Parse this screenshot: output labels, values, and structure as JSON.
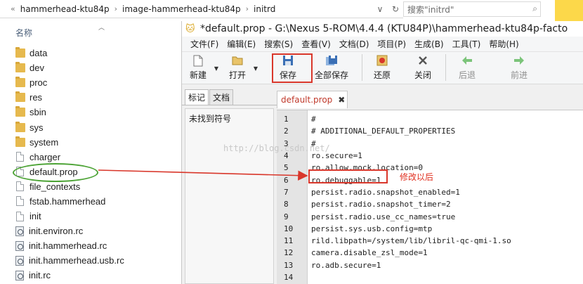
{
  "explorer": {
    "breadcrumbs": [
      "hammerhead-ktu84p",
      "image-hammerhead-ktu84p",
      "initrd"
    ],
    "search_placeholder": "搜索\"initrd\"",
    "column_name": "名称",
    "files": [
      {
        "name": "data",
        "type": "folder"
      },
      {
        "name": "dev",
        "type": "folder"
      },
      {
        "name": "proc",
        "type": "folder"
      },
      {
        "name": "res",
        "type": "folder"
      },
      {
        "name": "sbin",
        "type": "folder"
      },
      {
        "name": "sys",
        "type": "folder"
      },
      {
        "name": "system",
        "type": "folder"
      },
      {
        "name": "charger",
        "type": "file"
      },
      {
        "name": "default.prop",
        "type": "file"
      },
      {
        "name": "file_contexts",
        "type": "file"
      },
      {
        "name": "fstab.hammerhead",
        "type": "file"
      },
      {
        "name": "init",
        "type": "file"
      },
      {
        "name": "init.environ.rc",
        "type": "config"
      },
      {
        "name": "init.hammerhead.rc",
        "type": "config"
      },
      {
        "name": "init.hammerhead.usb.rc",
        "type": "config"
      },
      {
        "name": "init.rc",
        "type": "config"
      }
    ]
  },
  "editor": {
    "title": "*default.prop - G:\\Nexus 5-ROM\\4.4.4 (KTU84P)\\hammerhead-ktu84p-facto",
    "menu": [
      "文件(F)",
      "编辑(E)",
      "搜索(S)",
      "查看(V)",
      "文档(D)",
      "项目(P)",
      "生成(B)",
      "工具(T)",
      "帮助(H)"
    ],
    "toolbar": {
      "new": "新建",
      "open": "打开",
      "save": "保存",
      "save_all": "全部保存",
      "revert": "还原",
      "close": "关闭",
      "back": "后退",
      "forward": "前进"
    },
    "side_tabs": [
      "标记",
      "文档"
    ],
    "side_message": "未找到符号",
    "doc_tab": "default.prop",
    "code_lines": [
      "#",
      "# ADDITIONAL_DEFAULT_PROPERTIES",
      "#",
      "ro.secure=1",
      "ro.allow.mock.location=0",
      "ro.debuggable=1",
      "persist.radio.snapshot_enabled=1",
      "persist.radio.snapshot_timer=2",
      "persist.radio.use_cc_names=true",
      "persist.sys.usb.config=mtp",
      "rild.libpath=/system/lib/libril-qc-qmi-1.so",
      "camera.disable_zsl_mode=1",
      "ro.adb.secure=1",
      ""
    ],
    "line_numbers": [
      "1",
      "2",
      "3",
      "4",
      "5",
      "6",
      "7",
      "8",
      "9",
      "10",
      "11",
      "12",
      "13",
      "14"
    ]
  },
  "annotation": "修改以后",
  "watermark": "http://blog.csdn.net/",
  "colors": {
    "highlight_red": "#d9372b",
    "ellipse_green": "#4ca335",
    "tab_text": "#c0392b"
  }
}
